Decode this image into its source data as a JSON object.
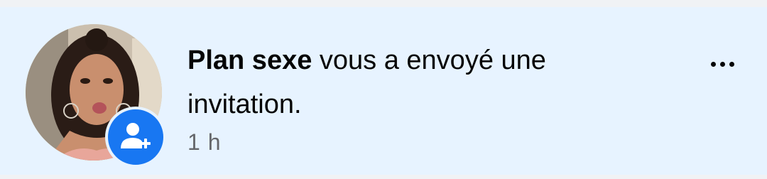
{
  "notification": {
    "actor_name": "Plan sexe",
    "message": " vous a envoyé une invitation.",
    "timestamp": "1 h",
    "badge_icon": "add-friend-icon",
    "more_icon": "more-options-icon",
    "accent_color": "#1877f2",
    "background_color": "#e7f3ff"
  }
}
